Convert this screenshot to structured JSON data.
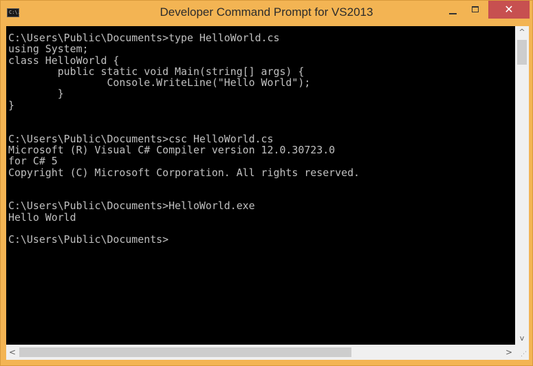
{
  "window": {
    "title": "Developer Command Prompt for VS2013",
    "icon_label": "C:\\.",
    "close_glyph": "✕",
    "accent_color": "#f3b453",
    "close_color": "#c75050"
  },
  "console": {
    "text": "C:\\Users\\Public\\Documents>type HelloWorld.cs\nusing System;\nclass HelloWorld {\n        public static void Main(string[] args) {\n                Console.WriteLine(\"Hello World\");\n        }\n}\n\n\nC:\\Users\\Public\\Documents>csc HelloWorld.cs\nMicrosoft (R) Visual C# Compiler version 12.0.30723.0\nfor C# 5\nCopyright (C) Microsoft Corporation. All rights reserved.\n\n\nC:\\Users\\Public\\Documents>HelloWorld.exe\nHello World\n\nC:\\Users\\Public\\Documents>",
    "background": "#000000",
    "foreground": "#c0c0c0"
  },
  "scrollbars": {
    "up_arrow": "^",
    "down_arrow": "v",
    "left_arrow": "<",
    "right_arrow": ">",
    "grip": "⋰"
  },
  "icons": {
    "app": "console-icon",
    "minimize": "minimize-icon",
    "maximize": "maximize-icon",
    "close": "close-icon"
  }
}
